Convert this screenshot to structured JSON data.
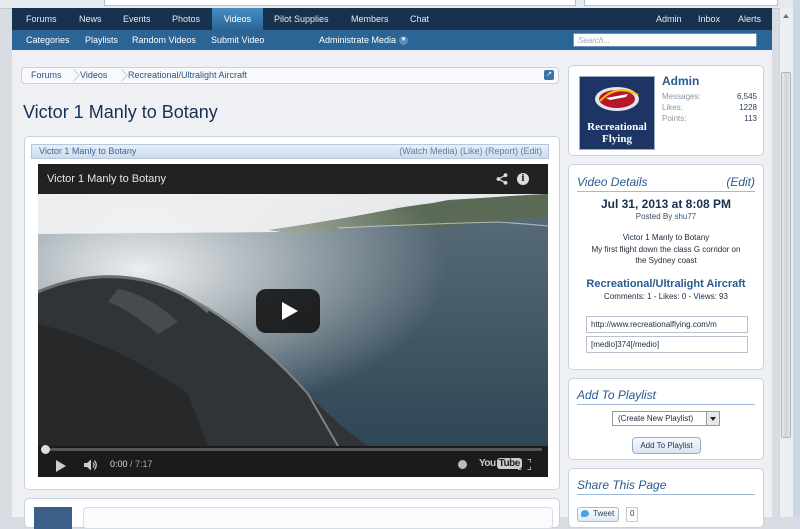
{
  "nav": {
    "tabs": [
      "Forums",
      "News",
      "Events",
      "Photos",
      "Videos",
      "Pilot Supplies",
      "Members",
      "Chat"
    ],
    "active_tab": "Videos",
    "right": [
      "Admin",
      "Inbox",
      "Alerts"
    ]
  },
  "subnav": {
    "items": [
      "Categories",
      "Playlists",
      "Random Videos",
      "Submit Video"
    ],
    "admin_menu": "Administrate Media"
  },
  "search": {
    "placeholder": "Search..."
  },
  "breadcrumb": [
    "Forums",
    "Videos",
    "Recreational/Ultralight Aircraft"
  ],
  "page_title": "Victor 1 Manly to Botany",
  "media": {
    "header_title": "Victor 1 Manly to Botany",
    "header_links": "(Watch Media) (Like) (Report) (Edit)",
    "player_title": "Victor 1 Manly to Botany",
    "time_current": "0:00",
    "time_total": "/ 7:17",
    "progress": 0.0,
    "brand_you": "You",
    "brand_tube": "Tube"
  },
  "user": {
    "name": "Admin",
    "avatar_text": [
      "Recreational",
      "Flying"
    ],
    "stats": [
      {
        "label": "Messages:",
        "value": "6,545"
      },
      {
        "label": "Likes:",
        "value": "1228"
      },
      {
        "label": "Points:",
        "value": "113"
      }
    ]
  },
  "details": {
    "title": "Video Details",
    "edit": "(Edit)",
    "date": "Jul 31, 2013 at 8:08 PM",
    "posted_by_label": "Posted By",
    "posted_by": "shu77",
    "desc_1": "Victor 1 Manly to Botany",
    "desc_2": "My first flight down the class G corridor on",
    "desc_3": "the Sydney coast",
    "category": "Recreational/Ultralight Aircraft",
    "counts": "Comments: 1 - Likes: 0 - Views: 93",
    "url_field": "http://www.recreationalflying.com/m",
    "bbcode_field": "[medio]374[/medio]"
  },
  "playlist": {
    "title": "Add To Playlist",
    "select_value": "(Create New Playlist)",
    "button": "Add To Playlist"
  },
  "share": {
    "title": "Share This Page",
    "tweet": "Tweet",
    "tweet_count": "0"
  },
  "colors": {
    "nav_bg": "#17314f",
    "subnav_bg": "#2b6596",
    "accent": "#2a5a90"
  }
}
